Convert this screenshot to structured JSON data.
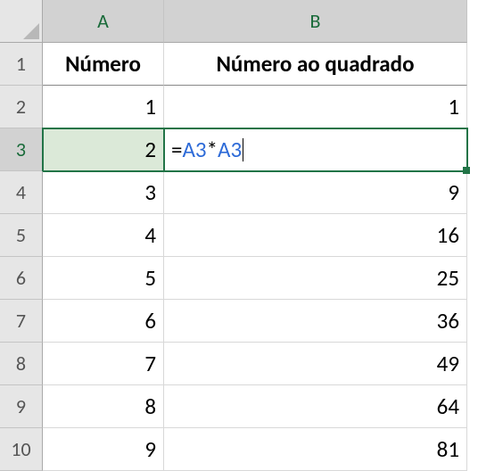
{
  "columns": {
    "A": "A",
    "B": "B"
  },
  "rowLabels": [
    "1",
    "2",
    "3",
    "4",
    "5",
    "6",
    "7",
    "8",
    "9",
    "10"
  ],
  "headers": {
    "A": "Número",
    "B": "Número ao quadrado"
  },
  "rows": [
    {
      "A": "1",
      "B": "1"
    },
    {
      "A": "2",
      "B": ""
    },
    {
      "A": "3",
      "B": "9"
    },
    {
      "A": "4",
      "B": "16"
    },
    {
      "A": "5",
      "B": "25"
    },
    {
      "A": "6",
      "B": "36"
    },
    {
      "A": "7",
      "B": "49"
    },
    {
      "A": "8",
      "B": "64"
    },
    {
      "A": "9",
      "B": "81"
    }
  ],
  "activeCell": "A3",
  "editingCell": "B3",
  "formula": {
    "eq": "=",
    "ref1": "A3",
    "op": "*",
    "ref2": "A3"
  },
  "chart_data": {
    "type": "table",
    "headers": [
      "Número",
      "Número ao quadrado"
    ],
    "rows": [
      [
        1,
        1
      ],
      [
        2,
        null
      ],
      [
        3,
        9
      ],
      [
        4,
        16
      ],
      [
        5,
        25
      ],
      [
        6,
        36
      ],
      [
        7,
        49
      ],
      [
        8,
        64
      ],
      [
        9,
        81
      ]
    ],
    "editing_formula": "=A3*A3"
  }
}
